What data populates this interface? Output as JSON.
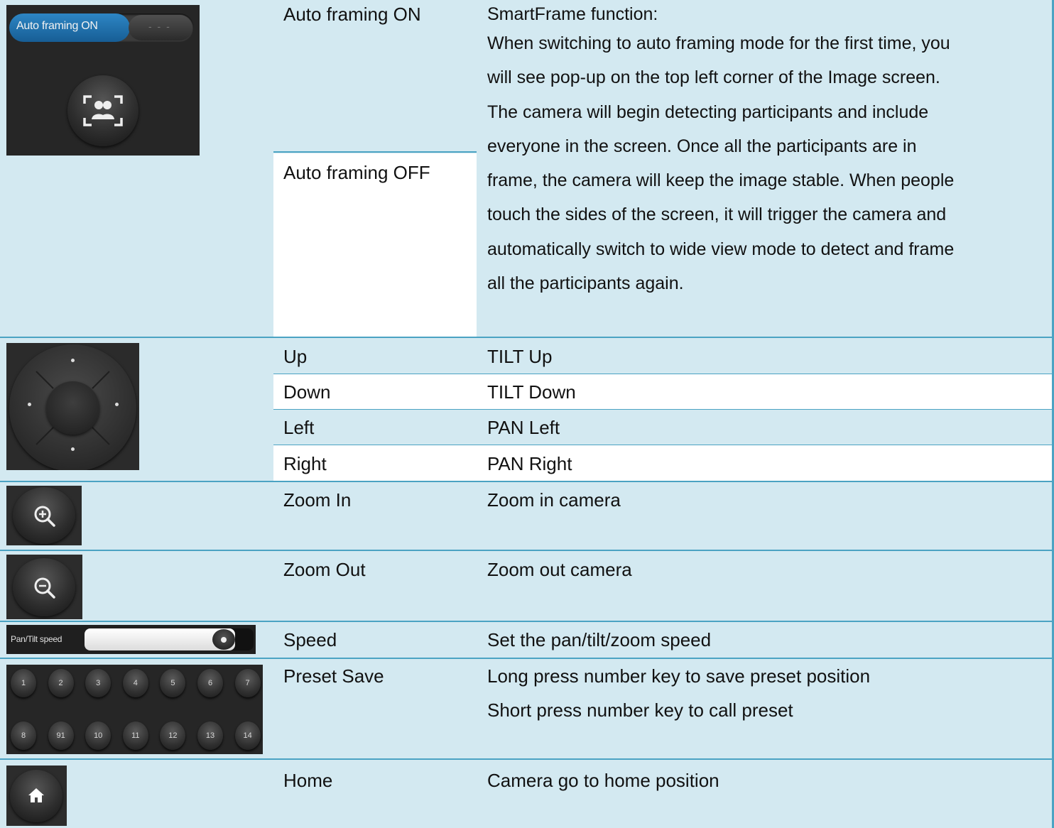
{
  "rows": {
    "af": {
      "on_label": "Auto framing ON",
      "off_label": "Auto framing OFF",
      "desc_title": "SmartFrame function:",
      "desc_lines": [
        "When switching to auto framing mode for the first time, you",
        "will see pop-up on the top left corner of the Image screen.",
        "The camera will begin detecting participants and include",
        "everyone in the screen. Once all the participants are in",
        "frame, the camera will keep the image stable. When people",
        "touch the sides of the screen, it will trigger the camera and",
        "automatically switch to wide view mode to detect and frame",
        "all the participants again."
      ],
      "img_toggle_label": "Auto framing ON"
    },
    "up": {
      "name": "Up",
      "desc": "TILT Up"
    },
    "down": {
      "name": "Down",
      "desc": "TILT Down"
    },
    "left": {
      "name": "Left",
      "desc": "PAN Left"
    },
    "right": {
      "name": "Right",
      "desc": "PAN Right"
    },
    "zoomin": {
      "name": "Zoom In",
      "desc": "Zoom in camera"
    },
    "zoomout": {
      "name": "Zoom Out",
      "desc": "Zoom out camera"
    },
    "speed": {
      "name": "Speed",
      "desc": "Set the pan/tilt/zoom speed",
      "img_label": "Pan/Tilt speed",
      "slider_level": 0.92
    },
    "preset": {
      "name": "Preset Save",
      "desc_line1": "Long press number key to save preset position",
      "desc_line2": "Short press number key to call preset",
      "keys_row1": [
        "1",
        "2",
        "3",
        "4",
        "5",
        "6",
        "7"
      ],
      "keys_row2": [
        "8",
        "91",
        "10",
        "11",
        "12",
        "13",
        "14"
      ]
    },
    "home": {
      "name": "Home",
      "desc": "Camera go to home position"
    }
  },
  "icons": {
    "af_button": "auto-framing-people-icon",
    "joystick": "pan-tilt-joystick-icon",
    "zoomin": "zoom-in-icon",
    "zoomout": "zoom-out-icon",
    "home": "home-icon"
  },
  "colors": {
    "row_blue": "#d3e9f1",
    "border": "#4ba3c3",
    "toggle_on": "#1f6fa8"
  }
}
